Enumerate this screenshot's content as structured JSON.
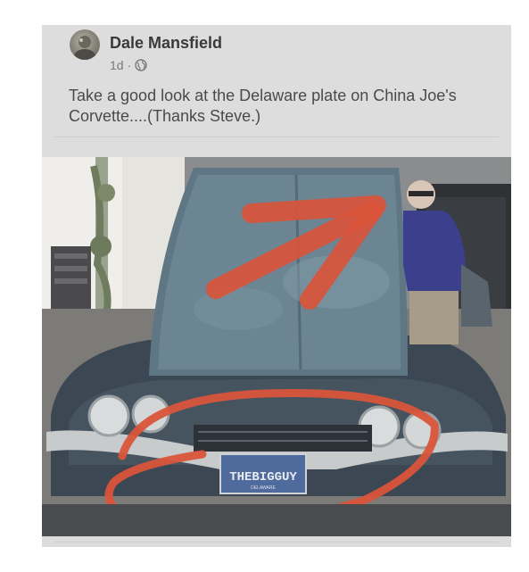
{
  "post": {
    "author": "Dale Mansfield",
    "time": "1d",
    "separator": "·",
    "privacy_icon": "globe-icon",
    "text": "Take a good look at the Delaware plate on China Joe's Corvette....(Thanks Steve.)"
  },
  "photo": {
    "plate_text": "THEBIGGUY",
    "plate_state": "DELAWARE",
    "annotation_color": "#d9543a"
  }
}
